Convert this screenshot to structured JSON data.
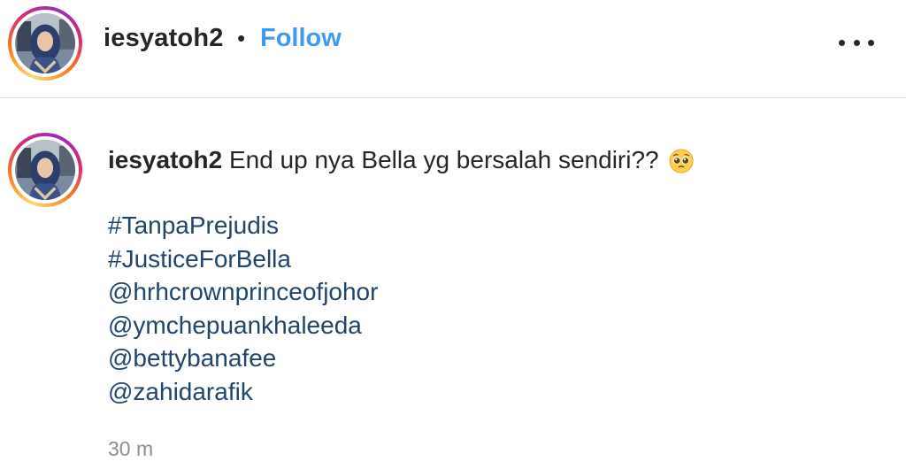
{
  "header": {
    "username": "iesyatoh2",
    "separator": "•",
    "follow_label": "Follow"
  },
  "caption": {
    "username": "iesyatoh2",
    "text": "End up nya Bella yg bersalah sendiri??",
    "emoji": "pleading-face-icon",
    "tags": [
      "#TanpaPrejudis",
      "#JusticeForBella",
      "@hrhcrownprinceofjohor",
      "@ymchepuankhaleeda",
      "@bettybanafee",
      "@zahidarafik"
    ],
    "timestamp": "30 m"
  },
  "colors": {
    "follow_blue": "#3f9bf0",
    "tag_blue": "#21456e",
    "text": "#262626",
    "muted": "#8e8e8e",
    "divider": "#dbdbdb"
  }
}
